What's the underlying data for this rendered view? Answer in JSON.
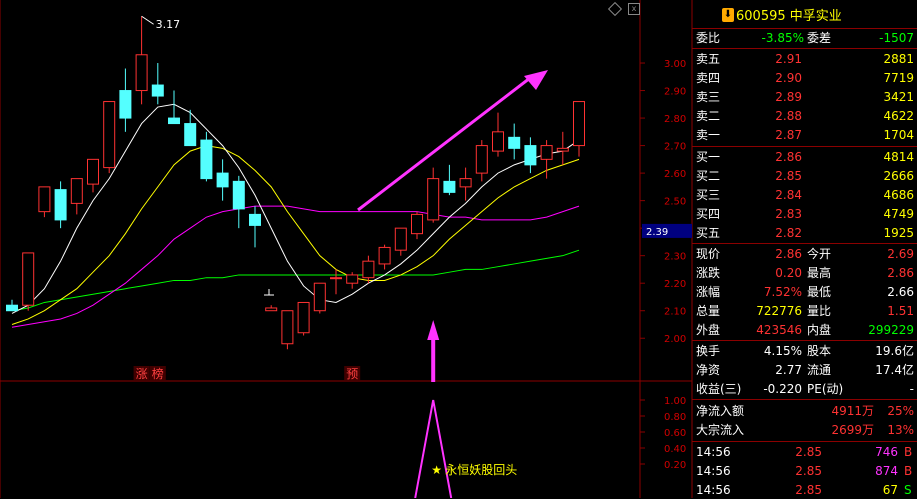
{
  "colors": {
    "up": "#ff3232",
    "down": "#54ffff",
    "ma5": "#ffffff",
    "ma10": "#ffff00",
    "ma20": "#ff00ff",
    "ma60": "#00ff00",
    "signal": "#ff33ff",
    "grid": "#8b0000",
    "label": "#ff4040",
    "green": "#00ff00",
    "white": "#ffffff",
    "yellow": "#ffff00"
  },
  "header": {
    "stock": "600595 中孚实业",
    "badge": "⬇"
  },
  "chart_data": {
    "type": "candlestick",
    "y_range": [
      1.95,
      3.12
    ],
    "price_axis": [
      "3.00",
      "2.90",
      "2.80",
      "2.70",
      "2.60",
      "2.50",
      "2.40",
      "2.30",
      "2.20",
      "2.10",
      "2.00"
    ],
    "price_label": "2.39",
    "high_mark": "3.17",
    "candles": [
      {
        "o": 2.12,
        "h": 2.14,
        "l": 2.11,
        "c": 2.1
      },
      {
        "o": 2.12,
        "h": 2.2,
        "l": 2.1,
        "c": 2.31
      },
      {
        "o": 2.46,
        "h": 2.52,
        "l": 2.44,
        "c": 2.55
      },
      {
        "o": 2.54,
        "h": 2.57,
        "l": 2.4,
        "c": 2.43
      },
      {
        "o": 2.49,
        "h": 2.56,
        "l": 2.45,
        "c": 2.58
      },
      {
        "o": 2.56,
        "h": 2.65,
        "l": 2.53,
        "c": 2.65
      },
      {
        "o": 2.62,
        "h": 2.85,
        "l": 2.6,
        "c": 2.86
      },
      {
        "o": 2.9,
        "h": 2.98,
        "l": 2.75,
        "c": 2.8
      },
      {
        "o": 2.9,
        "h": 3.17,
        "l": 2.85,
        "c": 3.03
      },
      {
        "o": 2.92,
        "h": 3.0,
        "l": 2.85,
        "c": 2.88
      },
      {
        "o": 2.8,
        "h": 2.9,
        "l": 2.78,
        "c": 2.78
      },
      {
        "o": 2.78,
        "h": 2.83,
        "l": 2.7,
        "c": 2.7
      },
      {
        "o": 2.72,
        "h": 2.75,
        "l": 2.57,
        "c": 2.58
      },
      {
        "o": 2.6,
        "h": 2.65,
        "l": 2.5,
        "c": 2.55
      },
      {
        "o": 2.57,
        "h": 2.59,
        "l": 2.4,
        "c": 2.47
      },
      {
        "o": 2.45,
        "h": 2.48,
        "l": 2.33,
        "c": 2.41
      },
      {
        "o": 2.1,
        "h": 2.12,
        "l": 2.1,
        "c": 2.11
      },
      {
        "o": 1.98,
        "h": 2.05,
        "l": 1.96,
        "c": 2.1
      },
      {
        "o": 2.02,
        "h": 2.1,
        "l": 2.01,
        "c": 2.13
      },
      {
        "o": 2.1,
        "h": 2.14,
        "l": 2.09,
        "c": 2.2
      },
      {
        "o": 2.22,
        "h": 2.25,
        "l": 2.16,
        "c": 2.22
      },
      {
        "o": 2.2,
        "h": 2.24,
        "l": 2.18,
        "c": 2.23
      },
      {
        "o": 2.22,
        "h": 2.3,
        "l": 2.2,
        "c": 2.28
      },
      {
        "o": 2.27,
        "h": 2.34,
        "l": 2.25,
        "c": 2.33
      },
      {
        "o": 2.32,
        "h": 2.4,
        "l": 2.3,
        "c": 2.4
      },
      {
        "o": 2.38,
        "h": 2.46,
        "l": 2.36,
        "c": 2.45
      },
      {
        "o": 2.43,
        "h": 2.62,
        "l": 2.42,
        "c": 2.58
      },
      {
        "o": 2.57,
        "h": 2.63,
        "l": 2.52,
        "c": 2.53
      },
      {
        "o": 2.55,
        "h": 2.62,
        "l": 2.5,
        "c": 2.58
      },
      {
        "o": 2.6,
        "h": 2.72,
        "l": 2.57,
        "c": 2.7
      },
      {
        "o": 2.68,
        "h": 2.82,
        "l": 2.66,
        "c": 2.75
      },
      {
        "o": 2.73,
        "h": 2.78,
        "l": 2.65,
        "c": 2.69
      },
      {
        "o": 2.7,
        "h": 2.73,
        "l": 2.6,
        "c": 2.63
      },
      {
        "o": 2.65,
        "h": 2.72,
        "l": 2.58,
        "c": 2.7
      },
      {
        "o": 2.68,
        "h": 2.75,
        "l": 2.63,
        "c": 2.69
      },
      {
        "o": 2.7,
        "h": 2.75,
        "l": 2.66,
        "c": 2.86
      }
    ],
    "ma5": [
      2.09,
      2.12,
      2.18,
      2.28,
      2.4,
      2.5,
      2.58,
      2.68,
      2.78,
      2.84,
      2.85,
      2.82,
      2.76,
      2.7,
      2.62,
      2.52,
      2.4,
      2.28,
      2.19,
      2.14,
      2.13,
      2.16,
      2.2,
      2.23,
      2.27,
      2.32,
      2.38,
      2.44,
      2.49,
      2.55,
      2.6,
      2.63,
      2.65,
      2.67,
      2.68,
      2.72
    ],
    "ma10": [
      2.05,
      2.07,
      2.1,
      2.14,
      2.18,
      2.24,
      2.3,
      2.38,
      2.47,
      2.55,
      2.63,
      2.68,
      2.7,
      2.69,
      2.66,
      2.61,
      2.55,
      2.46,
      2.38,
      2.3,
      2.25,
      2.22,
      2.21,
      2.21,
      2.23,
      2.26,
      2.3,
      2.36,
      2.41,
      2.46,
      2.51,
      2.55,
      2.58,
      2.61,
      2.63,
      2.65
    ],
    "ma20": [
      2.04,
      2.05,
      2.06,
      2.07,
      2.09,
      2.12,
      2.16,
      2.2,
      2.25,
      2.3,
      2.36,
      2.4,
      2.44,
      2.46,
      2.47,
      2.48,
      2.48,
      2.48,
      2.47,
      2.46,
      2.46,
      2.46,
      2.46,
      2.46,
      2.46,
      2.46,
      2.45,
      2.44,
      2.44,
      2.43,
      2.43,
      2.43,
      2.43,
      2.44,
      2.46,
      2.48
    ],
    "ma60": [
      2.1,
      2.11,
      2.13,
      2.14,
      2.15,
      2.16,
      2.17,
      2.18,
      2.19,
      2.2,
      2.21,
      2.21,
      2.22,
      2.22,
      2.23,
      2.23,
      2.23,
      2.23,
      2.23,
      2.23,
      2.23,
      2.23,
      2.23,
      2.23,
      2.23,
      2.23,
      2.23,
      2.24,
      2.25,
      2.25,
      2.26,
      2.27,
      2.28,
      2.29,
      2.3,
      2.32
    ],
    "markers": [
      {
        "index": 8,
        "text": "涨"
      },
      {
        "index": 9,
        "text": "榜"
      },
      {
        "index": 21,
        "text": "预"
      }
    ],
    "indicator": {
      "axis": [
        "1.00",
        "0.80",
        "0.60",
        "0.40",
        "0.20"
      ],
      "signal_index": 26,
      "label": "永恒妖股回头",
      "star": "★"
    }
  },
  "quote": {
    "weibi": {
      "label": "委比",
      "value": "-3.85%",
      "label2": "委差",
      "value2": "-1507"
    },
    "asks": [
      {
        "label": "卖五",
        "price": "2.91",
        "vol": "2881"
      },
      {
        "label": "卖四",
        "price": "2.90",
        "vol": "7719"
      },
      {
        "label": "卖三",
        "price": "2.89",
        "vol": "3421"
      },
      {
        "label": "卖二",
        "price": "2.88",
        "vol": "4622"
      },
      {
        "label": "卖一",
        "price": "2.87",
        "vol": "1704"
      }
    ],
    "bids": [
      {
        "label": "买一",
        "price": "2.86",
        "vol": "4814"
      },
      {
        "label": "买二",
        "price": "2.85",
        "vol": "2666"
      },
      {
        "label": "买三",
        "price": "2.84",
        "vol": "4686"
      },
      {
        "label": "买四",
        "price": "2.83",
        "vol": "4749"
      },
      {
        "label": "买五",
        "price": "2.82",
        "vol": "1925"
      }
    ],
    "stats": [
      {
        "l1": "现价",
        "v1": "2.86",
        "c1": "up",
        "l2": "今开",
        "v2": "2.69",
        "c2": "up"
      },
      {
        "l1": "涨跌",
        "v1": "0.20",
        "c1": "up",
        "l2": "最高",
        "v2": "2.86",
        "c2": "up"
      },
      {
        "l1": "涨幅",
        "v1": "7.52%",
        "c1": "up",
        "l2": "最低",
        "v2": "2.66",
        "c2": "white"
      },
      {
        "l1": "总量",
        "v1": "722776",
        "c1": "yellow",
        "l2": "量比",
        "v2": "1.51",
        "c2": "up"
      },
      {
        "l1": "外盘",
        "v1": "423546",
        "c1": "up",
        "l2": "内盘",
        "v2": "299229",
        "c2": "green"
      }
    ],
    "stats2": [
      {
        "l1": "换手",
        "v1": "4.15%",
        "l2": "股本",
        "v2": "19.6亿"
      },
      {
        "l1": "净资",
        "v1": "2.77",
        "l2": "流通",
        "v2": "17.4亿"
      },
      {
        "l1": "收益(三)",
        "v1": "-0.220",
        "l2": "PE(动)",
        "v2": "-"
      }
    ],
    "flows": [
      {
        "label": "净流入额",
        "value": "4911万",
        "pct": "25%"
      },
      {
        "label": "大宗流入",
        "value": "2699万",
        "pct": "13%"
      }
    ],
    "trades": [
      {
        "time": "14:56",
        "price": "2.85",
        "vol": "746",
        "side": "B"
      },
      {
        "time": "14:56",
        "price": "2.85",
        "vol": "874",
        "side": "B"
      },
      {
        "time": "14:56",
        "price": "2.85",
        "vol": "67",
        "side": "S"
      }
    ]
  }
}
